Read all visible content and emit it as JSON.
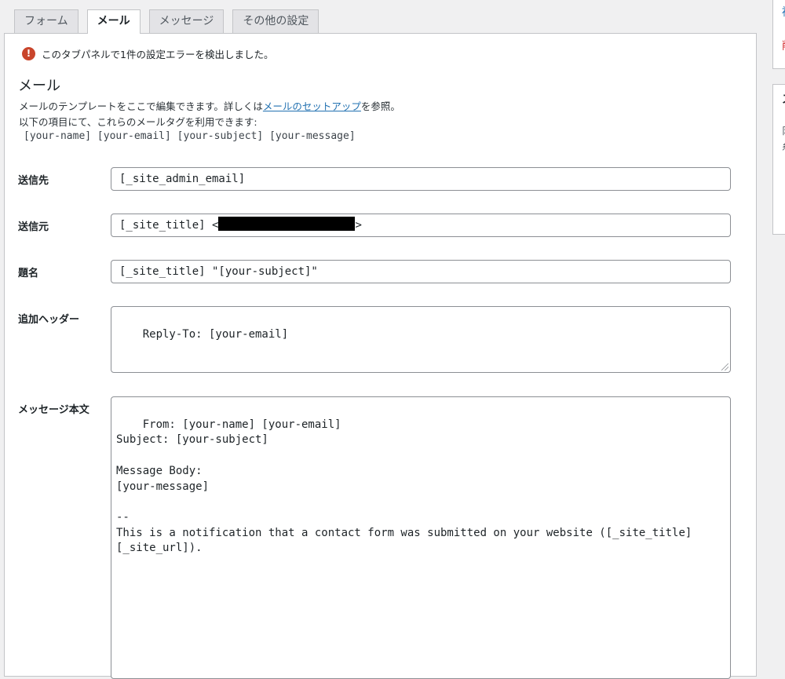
{
  "tabs": [
    {
      "label": "フォーム",
      "active": false
    },
    {
      "label": "メール",
      "active": true
    },
    {
      "label": "メッセージ",
      "active": false
    },
    {
      "label": "その他の設定",
      "active": false
    }
  ],
  "error_notice": "このタブパネルで1件の設定エラーを検出しました。",
  "section": {
    "title": "メール",
    "desc_before_link": "メールのテンプレートをここで編集できます。詳しくは",
    "desc_link": "メールのセットアップ",
    "desc_after_link": "を参照。",
    "desc_line2": "以下の項目にて、これらのメールタグを利用できます:",
    "mail_tags": "[your-name] [your-email] [your-subject] [your-message]"
  },
  "fields": {
    "to": {
      "label": "送信先",
      "value": "[_site_admin_email]"
    },
    "from": {
      "label": "送信元",
      "value_prefix": "[_site_title] <",
      "value_suffix": ">"
    },
    "subject": {
      "label": "題名",
      "value": "[_site_title] \"[your-subject]\""
    },
    "headers": {
      "label": "追加ヘッダー",
      "value": "Reply-To: [your-email]"
    },
    "body": {
      "label": "メッセージ本文",
      "value": "From: [your-name] [your-email]\nSubject: [your-subject]\n\nMessage Body:\n[your-message]\n\n-- \nThis is a notification that a contact form was submitted on your website ([_site_title]\n[_site_url])."
    }
  },
  "sidebar_fragments": {
    "top": "複",
    "second": "削",
    "box": "ス",
    "box_line1": "阝",
    "box_line2": "糸"
  },
  "colors": {
    "link": "#2271b1",
    "error_icon": "#c9452b",
    "delete_link": "#d63638"
  }
}
